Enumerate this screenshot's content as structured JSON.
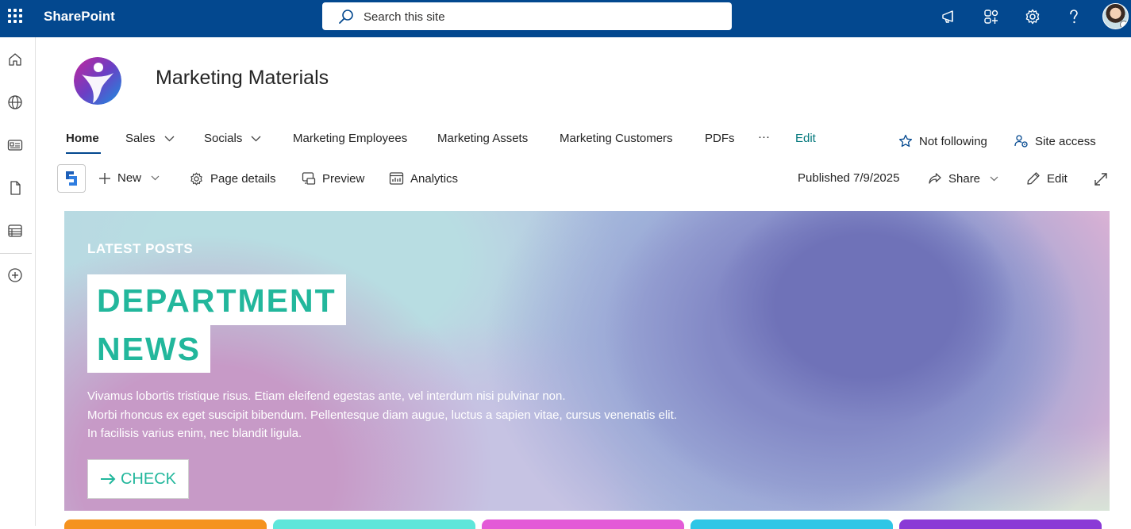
{
  "suite": {
    "app_name": "SharePoint",
    "search_placeholder": "Search this site"
  },
  "site": {
    "title": "Marketing Materials"
  },
  "nav": {
    "items": [
      {
        "label": "Home",
        "active": true,
        "has_dropdown": false
      },
      {
        "label": "Sales",
        "active": false,
        "has_dropdown": true
      },
      {
        "label": "Socials",
        "active": false,
        "has_dropdown": true
      },
      {
        "label": "Marketing Employees",
        "active": false,
        "has_dropdown": false
      },
      {
        "label": "Marketing Assets",
        "active": false,
        "has_dropdown": false
      },
      {
        "label": "Marketing Customers",
        "active": false,
        "has_dropdown": false
      },
      {
        "label": "PDFs",
        "active": false,
        "has_dropdown": false
      }
    ],
    "more": "···",
    "edit": "Edit",
    "follow_label": "Not following",
    "access_label": "Site access"
  },
  "commandbar": {
    "new_label": "New",
    "page_details_label": "Page details",
    "preview_label": "Preview",
    "analytics_label": "Analytics",
    "published": "Published 7/9/2025",
    "share_label": "Share",
    "edit_label": "Edit"
  },
  "hero": {
    "kicker": "LATEST POSTS",
    "headline_line1": "DEPARTMENT",
    "headline_line2": "NEWS",
    "body": [
      "Vivamus lobortis tristique risus. Etiam eleifend egestas ante, vel interdum nisi pulvinar non.",
      " Morbi rhoncus ex eget suscipit bibendum. Pellentesque diam augue, luctus a sapien vitae, cursus venenatis elit.",
      "In facilisis varius enim, nec blandit ligula."
    ],
    "cta_label": "CHECK"
  },
  "colors": {
    "suite_bar": "#03488f",
    "accent_teal": "#22b79c",
    "card_colors": [
      "#f5931f",
      "#5ee6da",
      "#e35ad7",
      "#2fc6e6",
      "#8a3ad6"
    ]
  }
}
